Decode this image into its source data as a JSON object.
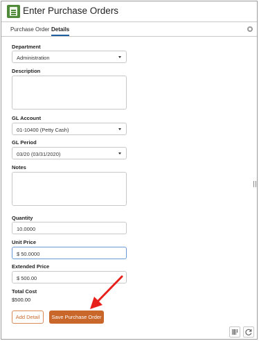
{
  "app": {
    "title": "Enter Purchase Orders",
    "icon": "spreadsheet-icon"
  },
  "tabs": [
    {
      "label": "Purchase Order",
      "active": false
    },
    {
      "label": "Details",
      "active": true
    }
  ],
  "form": {
    "department": {
      "label": "Department",
      "value": "Administration"
    },
    "description": {
      "label": "Description",
      "value": ""
    },
    "gl_account": {
      "label": "GL Account",
      "value": "01-10400 (Petty Cash)"
    },
    "gl_period": {
      "label": "GL Period",
      "value": "03/20 (03/31/2020)"
    },
    "notes": {
      "label": "Notes",
      "value": ""
    },
    "quantity": {
      "label": "Quantity",
      "value": "10.0000"
    },
    "unit_price": {
      "label": "Unit Price",
      "value": "$ 50.0000"
    },
    "extended_price": {
      "label": "Extended Price",
      "value": "$ 500.00"
    },
    "total_cost": {
      "label": "Total Cost",
      "value": "$500.00"
    }
  },
  "buttons": {
    "add_detail": "Add Detail",
    "save": "Save Purchase Order"
  },
  "colors": {
    "accent": "#c9662a",
    "tab_underline": "#1f5e9e",
    "annotation_arrow": "#e8201c"
  }
}
